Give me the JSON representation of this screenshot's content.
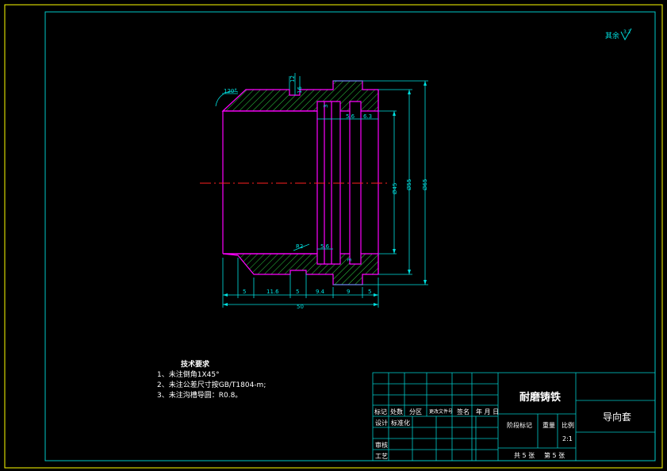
{
  "drawing": {
    "roughness": "其余",
    "roughness_value": "3.2",
    "dims": {
      "d12": "12",
      "d16": "16",
      "d_left": "5",
      "d_116": "11.6",
      "d5b": "5",
      "d94": "9.4",
      "d9": "9",
      "d5c": "5",
      "d50": "50",
      "d3a": "3",
      "d56a": "5.6",
      "d63": "6.3",
      "d56b": "5.6",
      "d3b": "3",
      "dia4": "Ø45",
      "dia55": "Ø55",
      "dia65": "Ø65",
      "angle": "120°",
      "ang2": "R2"
    }
  },
  "notes": {
    "title": "技术要求",
    "items": [
      "1、未注倒角1X45°",
      "2、未注公差尺寸按GB/T1804-m;",
      "3、未注沟槽导圆：R0.8。"
    ]
  },
  "title_block": {
    "material": "耐磨铸铁",
    "part_name": "导向套",
    "row_labels": [
      "标记",
      "处数",
      "分区",
      "更改文件号",
      "签名",
      "年 月 日"
    ],
    "designer": "设计",
    "standardize": "标准化",
    "review": "审核",
    "process": "工艺",
    "stage_mark": "阶段标记",
    "weight": "重量",
    "scale_label": "比例",
    "scale": "2:1",
    "sheets_total": "共 5 张",
    "sheet_no": "第 5 张"
  }
}
